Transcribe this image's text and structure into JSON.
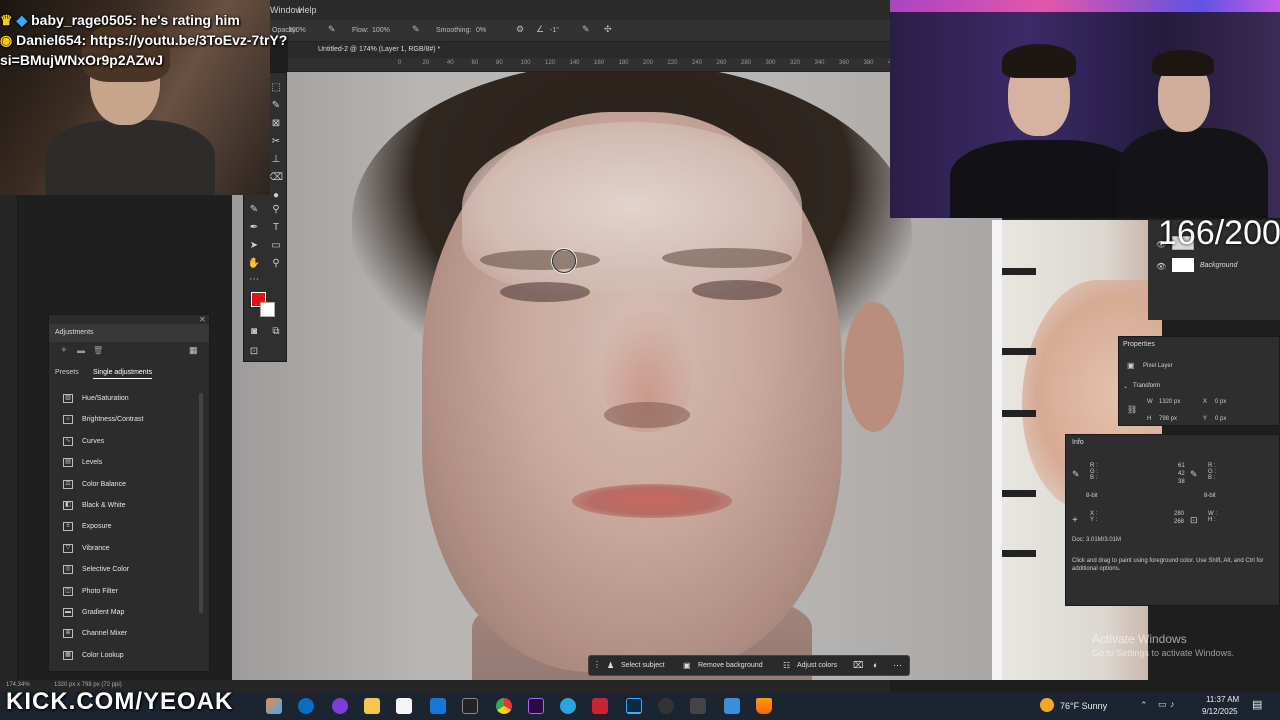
{
  "stream": {
    "chat": [
      {
        "user": "baby_rage0505",
        "message": "he's rating him"
      },
      {
        "user": "Daniel654",
        "message": "https://youtu.be/3ToEvz-7trY?si=BMujWNxOr9p2AZwJ"
      }
    ],
    "chat_line1": "baby_rage0505: he's rating him",
    "chat_line2": "Daniel654: https://youtu.be/3ToEvz-7trY?",
    "chat_line3": "si=BMujWNxOr9p2AZwJ",
    "counter": "166/200",
    "kick_url": "KICK.COM/YEOAK"
  },
  "photoshop": {
    "menu": {
      "window": "Window",
      "help": "Help"
    },
    "options": {
      "opacity_label": "Opacity:",
      "opacity_value": "100%",
      "flow_label": "Flow:",
      "flow_value": "100%",
      "smoothing_label": "Smoothing:",
      "smoothing_value": "0%",
      "angle_value": "-1°"
    },
    "document_tab": "Untitled-2 @ 174% (Layer 1, RGB/8#) *",
    "ruler_ticks": [
      "0",
      "20",
      "40",
      "60",
      "80",
      "100",
      "120",
      "140",
      "160",
      "180",
      "200",
      "220",
      "240",
      "260",
      "280",
      "300",
      "320",
      "340",
      "360",
      "380",
      "400",
      "420",
      "440",
      "460",
      "480",
      "500"
    ],
    "colors": {
      "foreground": "#e01414",
      "background": "#ffffff"
    },
    "adjustments": {
      "title": "Adjustments",
      "tabs": [
        "Presets",
        "Single adjustments"
      ],
      "active_tab": "Single adjustments",
      "items": [
        {
          "label": "Hue/Saturation",
          "icon": "hue-saturation-icon"
        },
        {
          "label": "Brightness/Contrast",
          "icon": "brightness-icon"
        },
        {
          "label": "Curves",
          "icon": "curves-icon"
        },
        {
          "label": "Levels",
          "icon": "levels-icon"
        },
        {
          "label": "Color Balance",
          "icon": "color-balance-icon"
        },
        {
          "label": "Black & White",
          "icon": "black-white-icon"
        },
        {
          "label": "Exposure",
          "icon": "exposure-icon"
        },
        {
          "label": "Vibrance",
          "icon": "vibrance-icon"
        },
        {
          "label": "Selective Color",
          "icon": "selective-color-icon"
        },
        {
          "label": "Photo Filter",
          "icon": "photo-filter-icon"
        },
        {
          "label": "Gradient Map",
          "icon": "gradient-map-icon"
        },
        {
          "label": "Channel Mixer",
          "icon": "channel-mixer-icon"
        },
        {
          "label": "Color Lookup",
          "icon": "color-lookup-icon"
        }
      ]
    },
    "layers": {
      "background_label": "Background"
    },
    "properties": {
      "title": "Properties",
      "kind": "Pixel Layer",
      "section": "Transform",
      "w_label": "W",
      "w_value": "1320 px",
      "h_label": "H",
      "h_value": "798 px",
      "x_label": "X",
      "x_value": "0 px",
      "y_label": "Y",
      "y_value": "0 px"
    },
    "info": {
      "title": "Info",
      "r": "61",
      "g": "42",
      "b": "38",
      "bit1": "8-bit",
      "bit2": "8-bit",
      "x": "280",
      "y": "268",
      "doc": "Doc: 3.01M/3.01M",
      "hint": "Click and drag to paint using foreground color. Use Shift, Alt, and Ctrl for additional options."
    },
    "context_bar": {
      "select_subject": "Select subject",
      "remove_background": "Remove background",
      "adjust_colors": "Adjust colors"
    },
    "status": {
      "zoom": "174.34%",
      "size": "1320 px x 798 px (72 ppi)"
    }
  },
  "windows": {
    "activate_title": "Activate Windows",
    "activate_sub": "Go to Settings to activate Windows.",
    "weather": "76°F  Sunny",
    "time": "11:37 AM",
    "date": "9/12/2025"
  }
}
